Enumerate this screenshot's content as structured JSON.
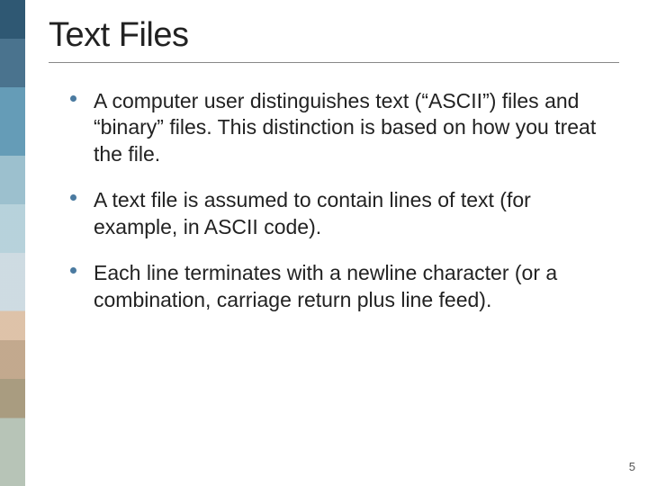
{
  "slide": {
    "title": "Text Files",
    "bullets": [
      "A computer user distinguishes text (“ASCII”) files and “binary” files.  This distinction is based on how you treat the file.",
      "A text file is assumed to contain lines of text (for example, in ASCII code).",
      "Each line terminates with a newline character (or a combination, carriage return plus line feed)."
    ],
    "page_number": "5"
  }
}
